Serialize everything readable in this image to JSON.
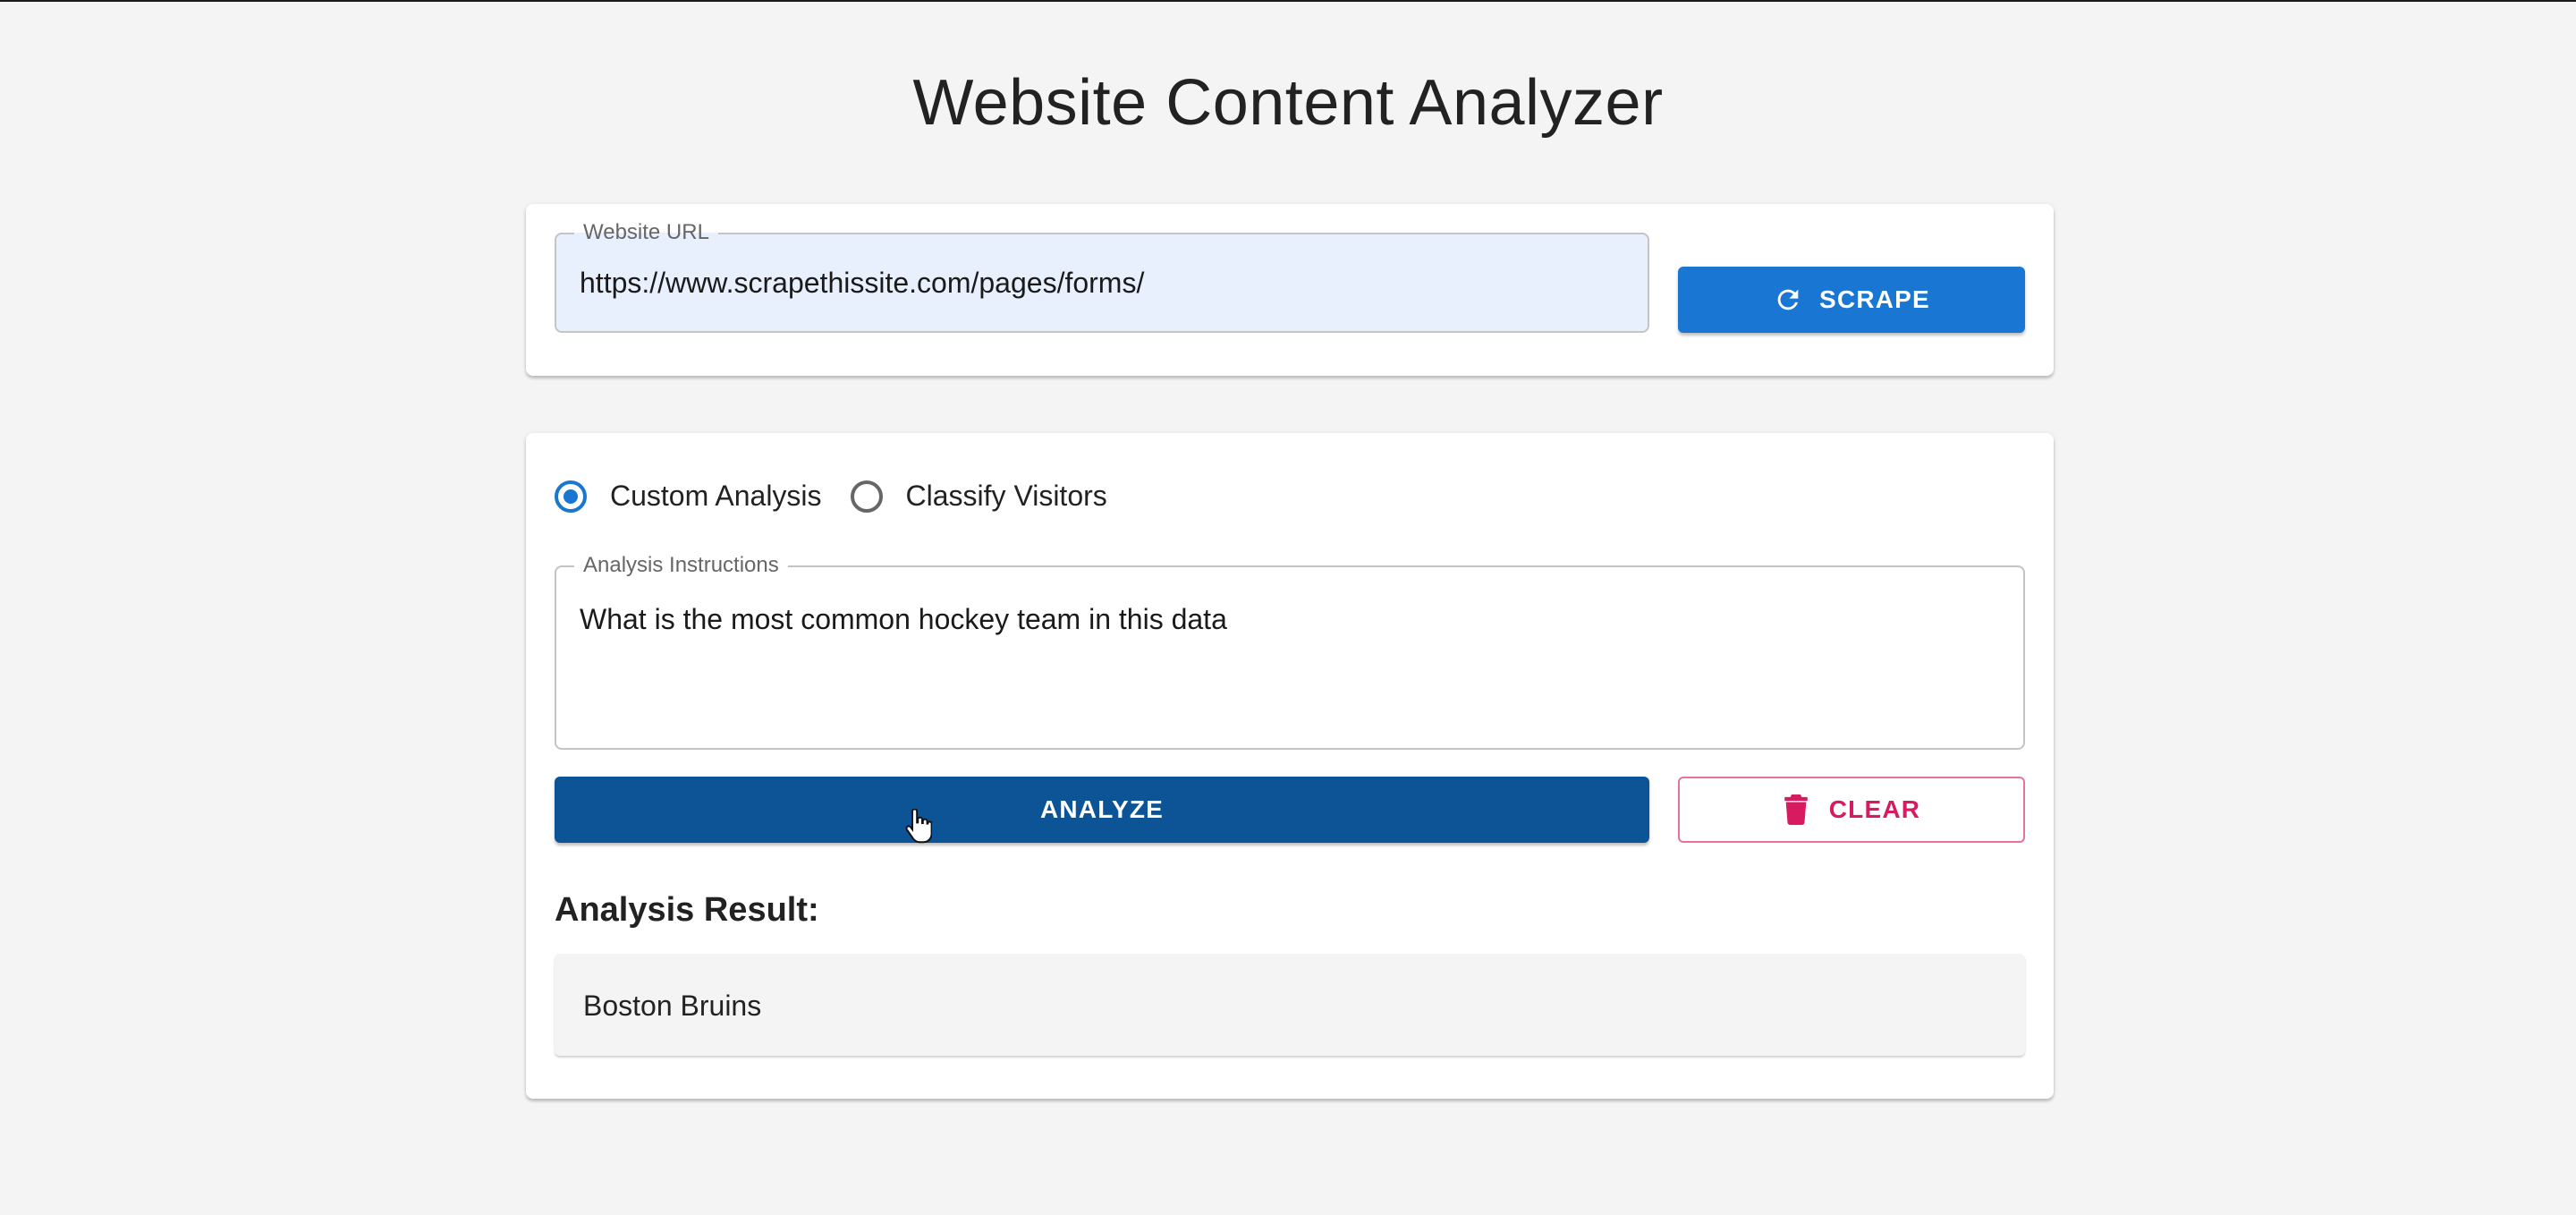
{
  "page": {
    "title": "Website Content Analyzer"
  },
  "url_form": {
    "legend": "Website URL",
    "value": "https://www.scrapethissite.com/pages/forms/",
    "scrape_label": "SCRAPE",
    "scrape_icon": "refresh-icon"
  },
  "analysis": {
    "radio_options": [
      {
        "label": "Custom Analysis",
        "checked": true
      },
      {
        "label": "Classify Visitors",
        "checked": false
      }
    ],
    "instructions_legend": "Analysis Instructions",
    "instructions_value": "What is the most common hockey team in this data",
    "analyze_label": "ANALYZE",
    "clear_label": "CLEAR",
    "clear_icon": "trash-icon",
    "result_heading": "Analysis Result:",
    "result_value": "Boston Bruins"
  },
  "colors": {
    "primary": "#1976d2",
    "primary_dark": "#0d5496",
    "danger": "#d81b60",
    "url_field_bg": "#e8f0fe",
    "page_bg": "#f4f4f4"
  }
}
